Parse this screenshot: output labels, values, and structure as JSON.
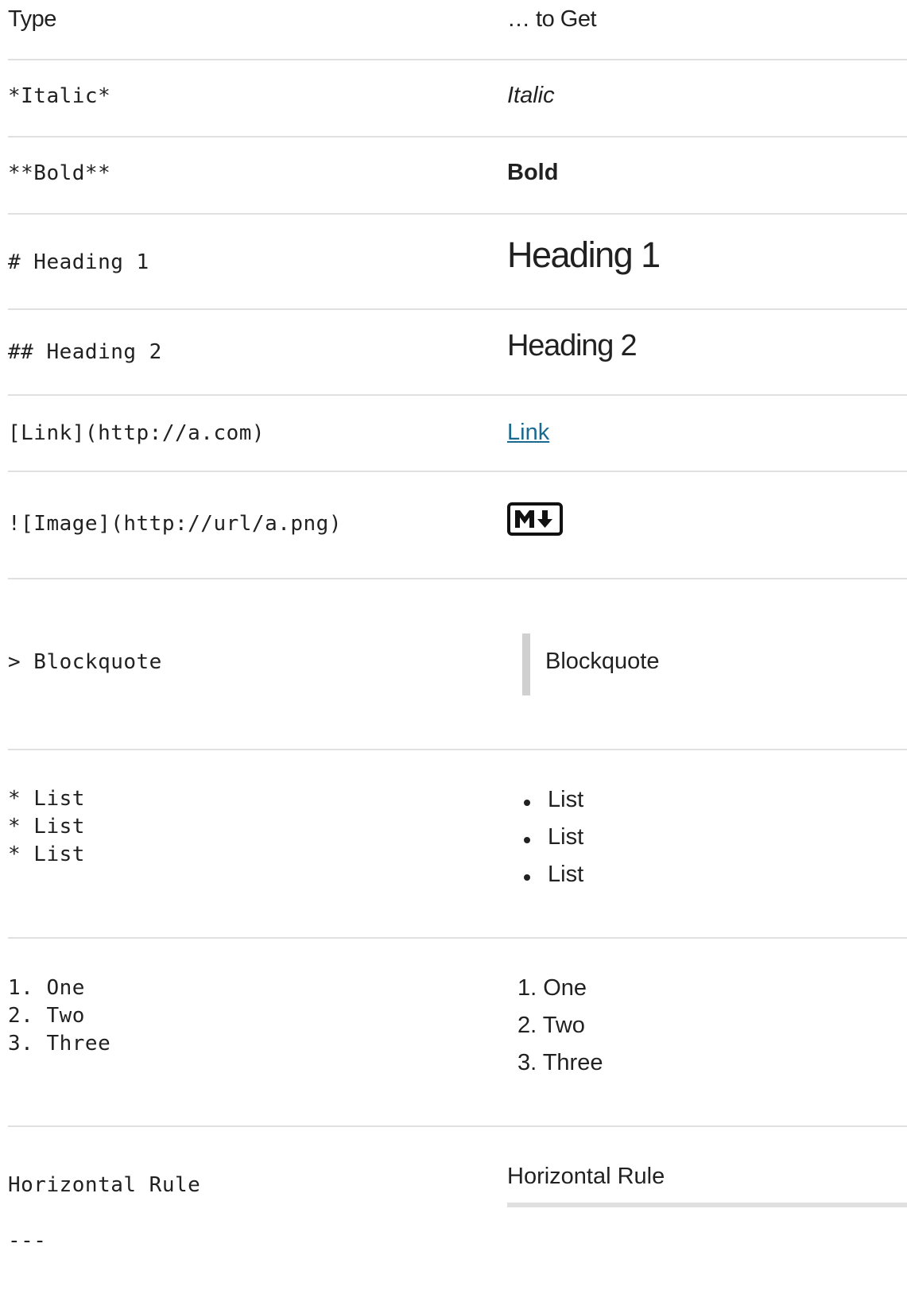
{
  "header": {
    "left": "Type",
    "right": "… to Get"
  },
  "rows": {
    "italic": {
      "type": "*Italic*",
      "get": "Italic"
    },
    "bold": {
      "type": "**Bold**",
      "get": "Bold"
    },
    "heading1": {
      "type": "# Heading 1",
      "get": "Heading 1"
    },
    "heading2": {
      "type": "## Heading 2",
      "get": "Heading 2"
    },
    "link": {
      "type": "[Link](http://a.com)",
      "get": "Link"
    },
    "image": {
      "type": "![Image](http://url/a.png)",
      "icon": "markdown-logo-icon"
    },
    "blockquote": {
      "type": "> Blockquote",
      "get": "Blockquote"
    },
    "list": {
      "type": [
        "* List",
        "* List",
        "* List"
      ],
      "get": [
        "List",
        "List",
        "List"
      ]
    },
    "ordered": {
      "type": [
        "1. One",
        "2. Two",
        "3. Three"
      ],
      "get": [
        "1. One",
        "2. Two",
        "3. Three"
      ]
    },
    "hr": {
      "type": [
        "Horizontal Rule",
        "---"
      ],
      "get": "Horizontal Rule"
    }
  },
  "colors": {
    "link": "#1a6a90",
    "rule": "#e0e0e0",
    "blockquote_bar": "#d0d0d0"
  }
}
